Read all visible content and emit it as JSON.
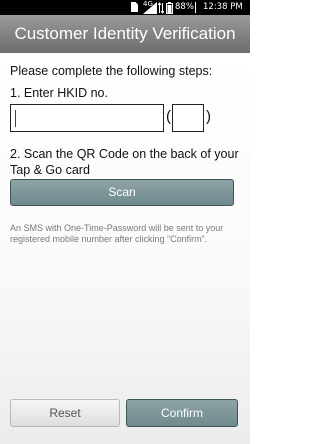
{
  "status_bar": {
    "network": "4G",
    "battery": "88%",
    "time": "12:38 PM",
    "icons": [
      "sim-icon",
      "signal-icon",
      "battery-icon"
    ]
  },
  "header": {
    "title": "Customer Identity Verification"
  },
  "instructions": {
    "heading": "Please complete the following steps:",
    "step1": "1. Enter HKID no.",
    "step2": "2. Scan the QR Code on the back of your Tap & Go card"
  },
  "hkid": {
    "number_value": "",
    "check_digit_value": "",
    "open_paren": "(",
    "close_paren": ")"
  },
  "scan_button": {
    "label": "Scan"
  },
  "sms_note": "An SMS with One-Time-Password will be sent to your registered mobile number after clicking “Confirm”.",
  "footer": {
    "reset_label": "Reset",
    "confirm_label": "Confirm"
  },
  "colors": {
    "header_bg": "#808080",
    "primary_button": "#7a9598",
    "secondary_button": "#e6e6e6",
    "note_text": "#7a7a7a"
  }
}
